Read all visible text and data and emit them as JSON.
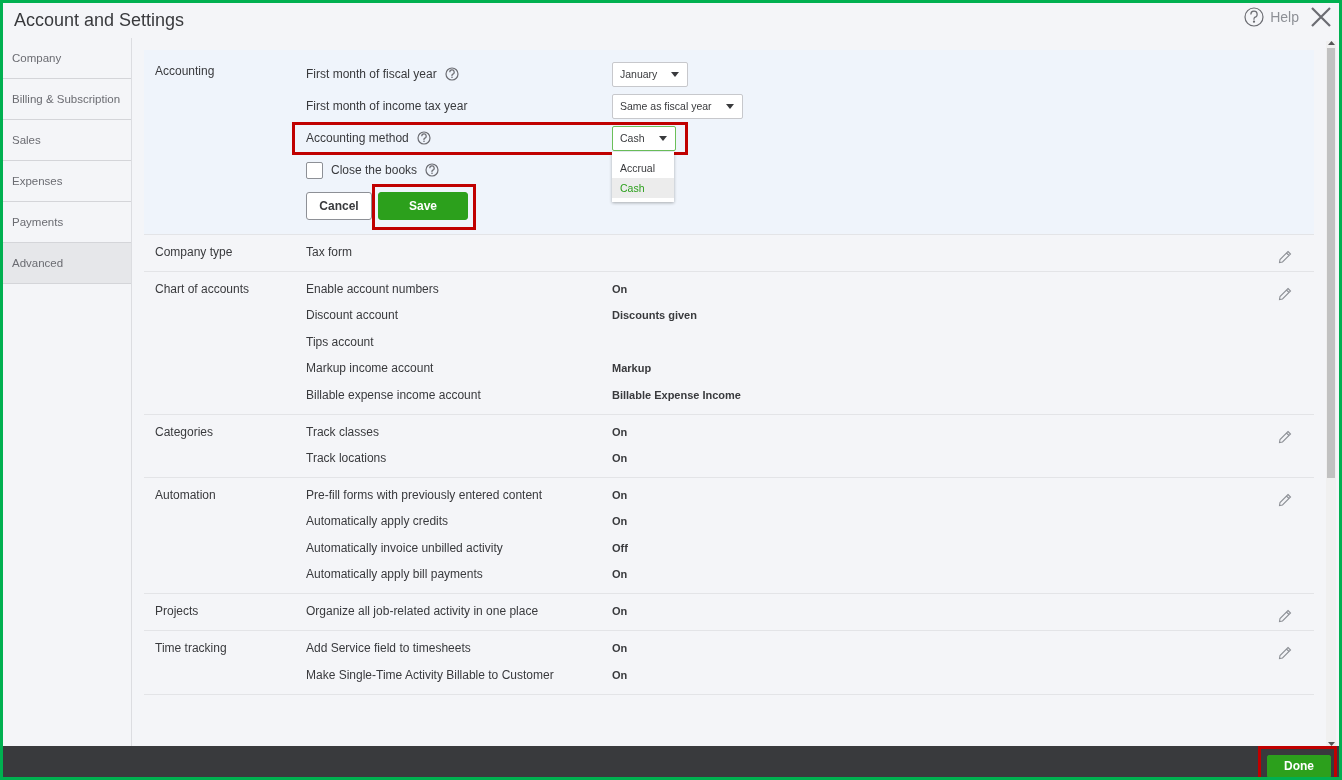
{
  "window": {
    "title": "Account and Settings",
    "help_label": "Help"
  },
  "sidebar": {
    "items": [
      {
        "label": "Company",
        "selected": false
      },
      {
        "label": "Billing & Subscription",
        "selected": false
      },
      {
        "label": "Sales",
        "selected": false
      },
      {
        "label": "Expenses",
        "selected": false
      },
      {
        "label": "Payments",
        "selected": false
      },
      {
        "label": "Advanced",
        "selected": true
      }
    ]
  },
  "editing_section": {
    "title": "Accounting",
    "fields": [
      {
        "kind": "select",
        "label": "First month of fiscal year",
        "help": true,
        "value": "January",
        "open": false,
        "highlighted": false
      },
      {
        "kind": "select",
        "label": "First month of income tax year",
        "help": false,
        "value": "Same as fiscal year",
        "open": false,
        "highlighted": false
      },
      {
        "kind": "select",
        "label": "Accounting method",
        "help": true,
        "value": "Cash",
        "open": true,
        "highlighted": true,
        "options": [
          {
            "label": "Accrual",
            "selected": false
          },
          {
            "label": "Cash",
            "selected": true
          }
        ]
      },
      {
        "kind": "checkbox",
        "label": "Close the books",
        "help": true,
        "checked": false
      }
    ],
    "buttons": [
      {
        "kind": "secondary",
        "label": "Cancel",
        "highlighted": false
      },
      {
        "kind": "primary",
        "label": "Save",
        "highlighted": true
      }
    ]
  },
  "sections": [
    {
      "title": "Company type",
      "settings": [
        {
          "label": "Tax form"
        }
      ]
    },
    {
      "title": "Chart of accounts",
      "settings": [
        {
          "label": "Enable account numbers",
          "value": "On"
        },
        {
          "label": "Discount account",
          "value": "Discounts given"
        },
        {
          "label": "Tips account"
        },
        {
          "label": "Markup income account",
          "value": "Markup"
        },
        {
          "label": "Billable expense income account",
          "value": "Billable Expense Income"
        }
      ]
    },
    {
      "title": "Categories",
      "settings": [
        {
          "label": "Track classes",
          "value": "On"
        },
        {
          "label": "Track locations",
          "value": "On"
        }
      ]
    },
    {
      "title": "Automation",
      "settings": [
        {
          "label": "Pre-fill forms with previously entered content",
          "value": "On"
        },
        {
          "label": "Automatically apply credits",
          "value": "On"
        },
        {
          "label": "Automatically invoice unbilled activity",
          "value": "Off"
        },
        {
          "label": "Automatically apply bill payments",
          "value": "On"
        }
      ]
    },
    {
      "title": "Projects",
      "settings": [
        {
          "label": "Organize all job-related activity in one place",
          "value": "On"
        }
      ]
    },
    {
      "title": "Time tracking",
      "settings": [
        {
          "label": "Add Service field to timesheets",
          "value": "On"
        },
        {
          "label": "Make Single-Time Activity Billable to Customer",
          "value": "On"
        }
      ]
    }
  ],
  "footer": {
    "done_button": {
      "label": "Done",
      "highlighted": true
    }
  }
}
